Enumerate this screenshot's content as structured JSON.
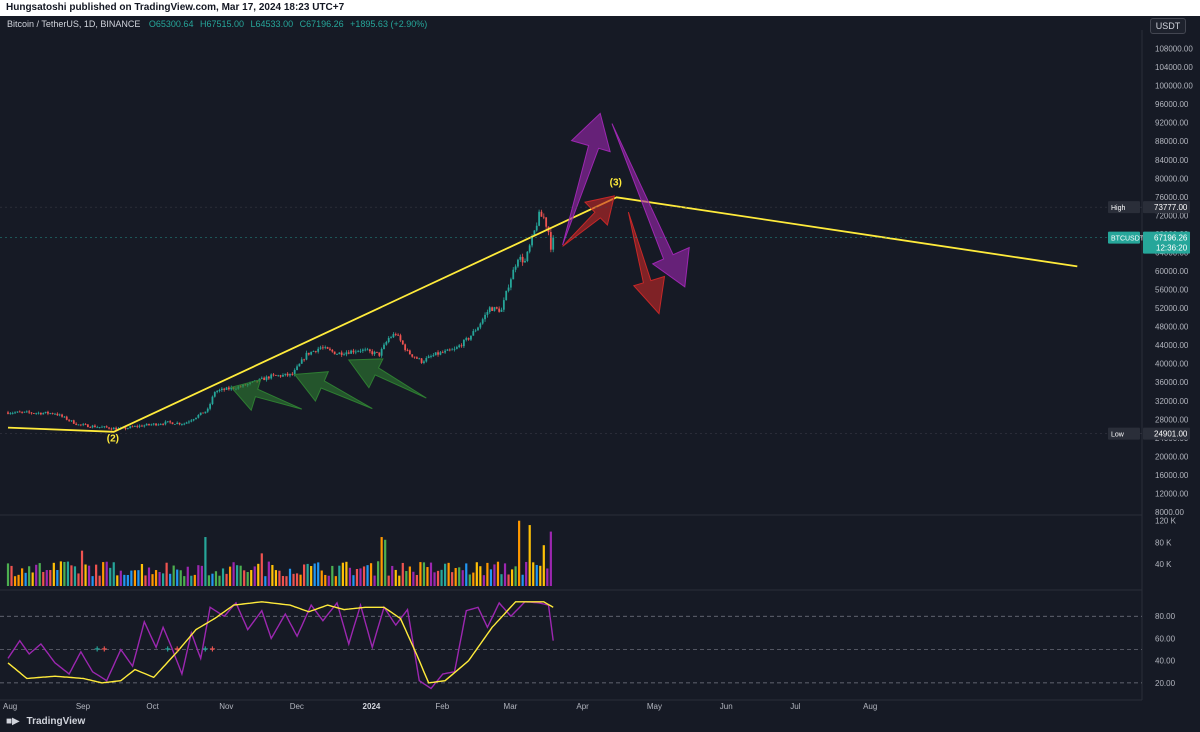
{
  "header": {
    "published": "Hungsatoshi published on TradingView.com, Mar 17, 2024 18:23 UTC+7"
  },
  "legend": {
    "symbol": "Bitcoin / TetherUS, 1D, BINANCE",
    "open": "O65300.64",
    "high": "H67515.00",
    "low": "L64533.00",
    "close": "C67196.26",
    "change": "+1895.63 (+2.90%)"
  },
  "currency": "USDT",
  "brand": "TradingView",
  "colors": {
    "background": "#161a25",
    "up": "#26a69a",
    "down": "#ef5350",
    "trendline": "#ffeb3b",
    "arrow_green": "#2e7d32",
    "arrow_purple": "#9c27b0",
    "arrow_red": "#c62828",
    "stoch_k": "#9c27b0",
    "stoch_d": "#ffeb3b"
  },
  "chart_data": [
    {
      "type": "candlestick",
      "ylim": [
        8000,
        112000
      ],
      "y_ticks": [
        "108000.00",
        "104000.00",
        "100000.00",
        "96000.00",
        "92000.00",
        "88000.00",
        "84000.00",
        "80000.00",
        "76000.00",
        "72000.00",
        "68000.00",
        "64000.00",
        "60000.00",
        "56000.00",
        "52000.00",
        "48000.00",
        "44000.00",
        "40000.00",
        "36000.00",
        "32000.00",
        "28000.00",
        "24000.00",
        "20000.00",
        "16000.00",
        "12000.00",
        "8000.00"
      ],
      "x_ticks": [
        "Aug",
        "Sep",
        "Oct",
        "Nov",
        "Dec",
        "2024",
        "Feb",
        "Mar",
        "Apr",
        "May",
        "Jun",
        "Jul",
        "Aug"
      ],
      "price_anchors": [
        {
          "day": 0,
          "price": 29500
        },
        {
          "day": 20,
          "price": 29300
        },
        {
          "day": 30,
          "price": 26800
        },
        {
          "day": 48,
          "price": 25900
        },
        {
          "day": 55,
          "price": 26500
        },
        {
          "day": 68,
          "price": 27300
        },
        {
          "day": 75,
          "price": 27100
        },
        {
          "day": 85,
          "price": 30000
        },
        {
          "day": 88,
          "price": 34000
        },
        {
          "day": 100,
          "price": 35200
        },
        {
          "day": 112,
          "price": 37300
        },
        {
          "day": 121,
          "price": 37600
        },
        {
          "day": 127,
          "price": 42000
        },
        {
          "day": 133,
          "price": 43500
        },
        {
          "day": 140,
          "price": 42200
        },
        {
          "day": 150,
          "price": 43000
        },
        {
          "day": 158,
          "price": 42000
        },
        {
          "day": 162,
          "price": 45500
        },
        {
          "day": 165,
          "price": 46500
        },
        {
          "day": 170,
          "price": 42500
        },
        {
          "day": 176,
          "price": 40500
        },
        {
          "day": 182,
          "price": 42000
        },
        {
          "day": 190,
          "price": 43000
        },
        {
          "day": 196,
          "price": 45500
        },
        {
          "day": 200,
          "price": 48000
        },
        {
          "day": 205,
          "price": 52000
        },
        {
          "day": 210,
          "price": 51500
        },
        {
          "day": 213,
          "price": 57000
        },
        {
          "day": 217,
          "price": 63000
        },
        {
          "day": 220,
          "price": 62000
        },
        {
          "day": 224,
          "price": 68500
        },
        {
          "day": 226,
          "price": 72000
        },
        {
          "day": 228,
          "price": 71500
        },
        {
          "day": 230,
          "price": 68500
        },
        {
          "day": 231,
          "price": 65300
        },
        {
          "day": 232,
          "price": 67196
        }
      ],
      "trendline": [
        {
          "day": 0,
          "price": 26200
        },
        {
          "day": 45,
          "price": 25300
        },
        {
          "day": 259,
          "price": 75900
        },
        {
          "day": 455,
          "price": 61000
        }
      ],
      "labels": [
        {
          "text": "(2)",
          "day": 45,
          "price": 23200
        },
        {
          "text": "(3)",
          "day": 259,
          "price": 78500
        }
      ],
      "markers": [
        {
          "label": "High",
          "value": "73777.00",
          "price": 73777
        },
        {
          "label": "BTCUSDT",
          "value": "67196.26",
          "countdown": "12:36:20",
          "price": 67196
        },
        {
          "label": "Low",
          "value": "24901.00",
          "price": 24901
        }
      ],
      "arrows": [
        {
          "color": "green",
          "from": {
            "day": 125,
            "price": 30200
          },
          "to": {
            "day": 95,
            "price": 34900
          }
        },
        {
          "color": "green",
          "from": {
            "day": 155,
            "price": 30300
          },
          "to": {
            "day": 122,
            "price": 37700
          }
        },
        {
          "color": "green",
          "from": {
            "day": 178,
            "price": 32600
          },
          "to": {
            "day": 145,
            "price": 40800
          }
        },
        {
          "color": "purple",
          "from": {
            "day": 236,
            "price": 65600
          },
          "to": {
            "day": 252,
            "price": 94000
          }
        },
        {
          "color": "purple",
          "from": {
            "day": 257,
            "price": 91800
          },
          "to": {
            "day": 288,
            "price": 56600
          }
        },
        {
          "color": "red",
          "from": {
            "day": 236,
            "price": 65300
          },
          "to": {
            "day": 258,
            "price": 76200
          }
        },
        {
          "color": "red",
          "from": {
            "day": 264,
            "price": 72700
          },
          "to": {
            "day": 277,
            "price": 50800
          }
        }
      ]
    },
    {
      "type": "bar",
      "name": "volume",
      "ylim": [
        0,
        125000
      ],
      "y_ticks": [
        "120 K",
        "80 K",
        "40 K"
      ],
      "tick_values": [
        120000,
        80000,
        40000
      ],
      "spikes": [
        {
          "day": 19,
          "value": 75000
        },
        {
          "day": 32,
          "value": 65000
        },
        {
          "day": 76,
          "value": 80000
        },
        {
          "day": 82,
          "value": 120000
        },
        {
          "day": 84,
          "value": 90000
        },
        {
          "day": 108,
          "value": 60000
        },
        {
          "day": 124,
          "value": 70000
        },
        {
          "day": 159,
          "value": 90000
        },
        {
          "day": 161,
          "value": 85000
        },
        {
          "day": 163,
          "value": 85000
        },
        {
          "day": 175,
          "value": 65000
        },
        {
          "day": 218,
          "value": 120000
        },
        {
          "day": 220,
          "value": 80000
        },
        {
          "day": 222,
          "value": 112000
        },
        {
          "day": 226,
          "value": 130000
        },
        {
          "day": 228,
          "value": 75000
        },
        {
          "day": 231,
          "value": 100000
        }
      ]
    },
    {
      "type": "line",
      "name": "stochastic",
      "ylim": [
        10,
        100
      ],
      "y_ticks": [
        "80.00",
        "60.00",
        "40.00",
        "20.00"
      ],
      "tick_values": [
        80,
        60,
        40,
        20
      ],
      "levels": [
        80,
        50,
        20
      ],
      "d_anchors": [
        {
          "day": 0,
          "value": 38
        },
        {
          "day": 8,
          "value": 24
        },
        {
          "day": 20,
          "value": 26
        },
        {
          "day": 32,
          "value": 24
        },
        {
          "day": 40,
          "value": 20
        },
        {
          "day": 48,
          "value": 22
        },
        {
          "day": 54,
          "value": 32
        },
        {
          "day": 62,
          "value": 25
        },
        {
          "day": 72,
          "value": 48
        },
        {
          "day": 80,
          "value": 68
        },
        {
          "day": 88,
          "value": 78
        },
        {
          "day": 96,
          "value": 90
        },
        {
          "day": 108,
          "value": 93
        },
        {
          "day": 120,
          "value": 90
        },
        {
          "day": 128,
          "value": 84
        },
        {
          "day": 136,
          "value": 90
        },
        {
          "day": 143,
          "value": 86
        },
        {
          "day": 152,
          "value": 88
        },
        {
          "day": 160,
          "value": 88
        },
        {
          "day": 167,
          "value": 78
        },
        {
          "day": 174,
          "value": 45
        },
        {
          "day": 179,
          "value": 20
        },
        {
          "day": 186,
          "value": 22
        },
        {
          "day": 196,
          "value": 40
        },
        {
          "day": 206,
          "value": 70
        },
        {
          "day": 216,
          "value": 93
        },
        {
          "day": 228,
          "value": 93
        },
        {
          "day": 232,
          "value": 88
        }
      ],
      "k_anchors": [
        {
          "day": 0,
          "value": 42
        },
        {
          "day": 5,
          "value": 58
        },
        {
          "day": 9,
          "value": 46
        },
        {
          "day": 14,
          "value": 55
        },
        {
          "day": 20,
          "value": 38
        },
        {
          "day": 26,
          "value": 28
        },
        {
          "day": 31,
          "value": 48
        },
        {
          "day": 36,
          "value": 30
        },
        {
          "day": 42,
          "value": 22
        },
        {
          "day": 48,
          "value": 50
        },
        {
          "day": 53,
          "value": 35
        },
        {
          "day": 58,
          "value": 75
        },
        {
          "day": 63,
          "value": 52
        },
        {
          "day": 66,
          "value": 70
        },
        {
          "day": 70,
          "value": 50
        },
        {
          "day": 74,
          "value": 28
        },
        {
          "day": 78,
          "value": 65
        },
        {
          "day": 82,
          "value": 42
        },
        {
          "day": 86,
          "value": 88
        },
        {
          "day": 92,
          "value": 80
        },
        {
          "day": 97,
          "value": 92
        },
        {
          "day": 102,
          "value": 68
        },
        {
          "day": 108,
          "value": 85
        },
        {
          "day": 112,
          "value": 60
        },
        {
          "day": 118,
          "value": 82
        },
        {
          "day": 123,
          "value": 62
        },
        {
          "day": 129,
          "value": 90
        },
        {
          "day": 134,
          "value": 76
        },
        {
          "day": 140,
          "value": 92
        },
        {
          "day": 145,
          "value": 55
        },
        {
          "day": 150,
          "value": 90
        },
        {
          "day": 155,
          "value": 52
        },
        {
          "day": 160,
          "value": 88
        },
        {
          "day": 165,
          "value": 72
        },
        {
          "day": 170,
          "value": 86
        },
        {
          "day": 175,
          "value": 22
        },
        {
          "day": 180,
          "value": 15
        },
        {
          "day": 185,
          "value": 28
        },
        {
          "day": 190,
          "value": 30
        },
        {
          "day": 195,
          "value": 85
        },
        {
          "day": 200,
          "value": 88
        },
        {
          "day": 204,
          "value": 70
        },
        {
          "day": 209,
          "value": 92
        },
        {
          "day": 214,
          "value": 80
        },
        {
          "day": 220,
          "value": 93
        },
        {
          "day": 226,
          "value": 92
        },
        {
          "day": 230,
          "value": 90
        },
        {
          "day": 232,
          "value": 58
        }
      ],
      "cross_days": [
        38,
        41,
        68,
        72,
        84,
        87
      ]
    }
  ]
}
